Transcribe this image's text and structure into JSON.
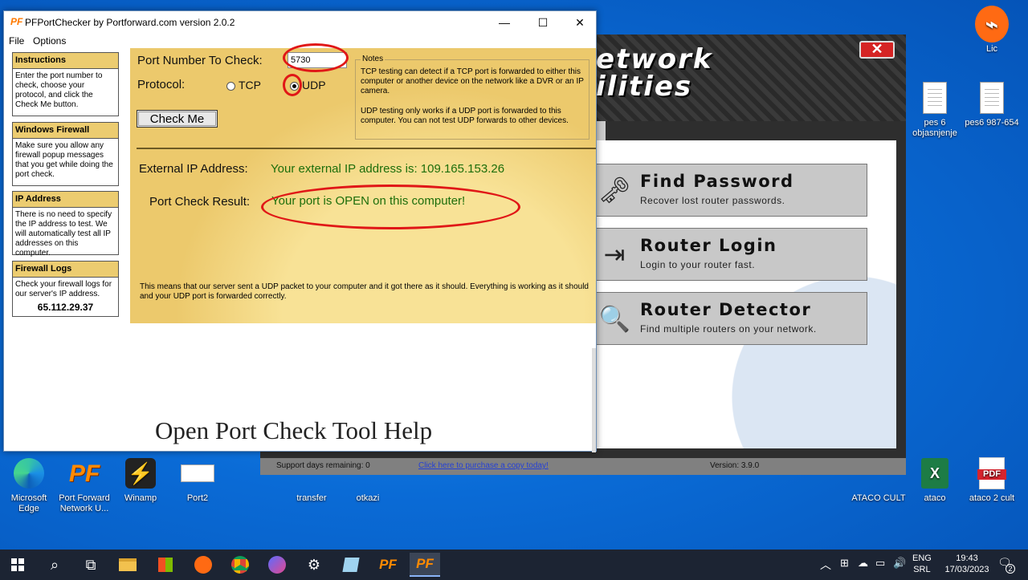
{
  "window": {
    "title": "PFPortChecker by Portforward.com version 2.0.2",
    "minimize": "—",
    "maximize": "☐",
    "close": "✕"
  },
  "menu": {
    "file": "File",
    "options": "Options"
  },
  "sidebar": [
    {
      "header": "Instructions",
      "text": "Enter the port number to check, choose your protocol, and click the Check Me button."
    },
    {
      "header": "Windows Firewall",
      "text": "Make sure you allow any firewall popup messages that you get while doing the port check."
    },
    {
      "header": "IP Address",
      "text": "There is no need to specify the IP address to test. We will automatically test all IP addresses on this computer."
    },
    {
      "header": "Firewall Logs",
      "text": "Check your firewall logs for our server's IP address.",
      "ip": "65.112.29.37"
    }
  ],
  "form": {
    "port_label": "Port Number To Check:",
    "port_value": "5730",
    "protocol_label": "Protocol:",
    "tcp_label": "TCP",
    "udp_label": "UDP",
    "selected_protocol": "UDP",
    "check_button": "Check Me"
  },
  "notes": {
    "header": "Notes",
    "tcp_text": "TCP testing can detect if a TCP port is forwarded to either this computer or another device on the network like a DVR or an IP camera.",
    "udp_text": "UDP testing only works if a UDP port is forwarded to this computer. You can not test UDP forwards to other devices."
  },
  "result": {
    "external_ip_label": "External IP Address:",
    "external_ip_text": "Your external IP address is: 109.165.153.26",
    "port_result_label": "Port Check Result:",
    "port_result_text": "Your port is OPEN on this computer!",
    "explanation": "This means that our server sent a UDP packet to your computer and it got there as it should. Everything is working as it should and your UDP port is forwarded correctly."
  },
  "help_title": "Open Port Check Tool Help",
  "background_app": {
    "title_line1": "etwork",
    "title_line2": "ilities",
    "close": "✕",
    "buttons": [
      {
        "title": "Find Password",
        "subtitle": "Recover lost router passwords."
      },
      {
        "title": "Router Login",
        "subtitle": "Login to your router fast."
      },
      {
        "title": "Router Detector",
        "subtitle": "Find multiple routers on your network."
      }
    ],
    "status": {
      "support": "Support days remaining: 0",
      "purchase_link": "Click here to purchase a copy today!",
      "version": "Version: 3.9.0"
    }
  },
  "desktop_icons": {
    "lic": "Lic",
    "pes6_objasnjenje": "pes 6 objasnjenje",
    "pes6_987": "pes6 987-654",
    "edge": "Microsoft Edge",
    "portforward": "Port Forward Network U...",
    "winamp": "Winamp",
    "port2": "Port2",
    "transfer": "transfer",
    "otkazi": "otkazi",
    "ataco_cult": "ATACO CULT",
    "ataco": "ataco",
    "ataco2": "ataco 2 cult",
    "excel_letter": "X",
    "pdf_label": "PDF"
  },
  "taskbar": {
    "lang": "ENG",
    "layout": "SRL",
    "time": "19:43",
    "date": "17/03/2023",
    "notifications": "2"
  },
  "colors": {
    "panel": "#ecc96c",
    "result_green": "#1d6e0b",
    "highlight_ring": "#e01717"
  }
}
